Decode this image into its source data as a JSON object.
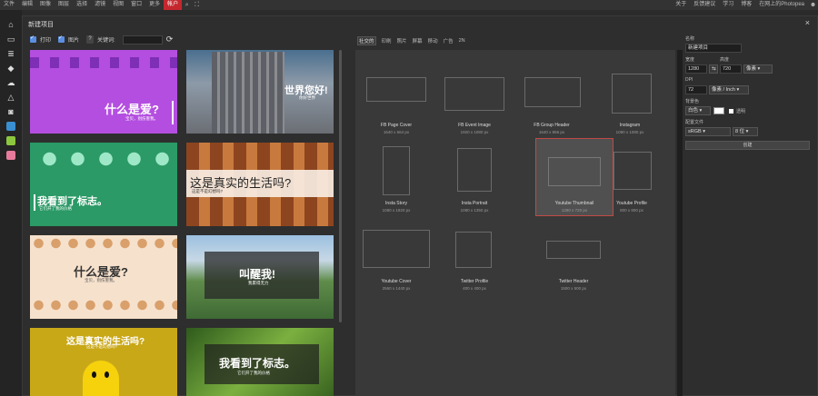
{
  "menubar": {
    "items": [
      "文件",
      "编辑",
      "图像",
      "图层",
      "选择",
      "滤镜",
      "视图",
      "窗口",
      "更多"
    ],
    "account": "帐户",
    "right_items": [
      "关于",
      "反馈建议",
      "学习",
      "博客",
      "在网上的Photopea"
    ]
  },
  "dialog": {
    "title": "新建项目",
    "close": "×"
  },
  "template_toolbar": {
    "print_label": "打印",
    "image_label": "图片",
    "question": "?",
    "keyword_label": "关键词:",
    "keyword_value": ""
  },
  "templates": [
    {
      "big": "什么是爱?",
      "small": "宝贝，别伤害我。",
      "bg": "#b44ee0"
    },
    {
      "big": "世界您好!",
      "small": "你好世界",
      "bg": "#6d7a8c"
    },
    {
      "big": "我看到了标志。",
      "small": "它们开了我的价格",
      "bg": "#2b9a66"
    },
    {
      "big": "这是真实的生活吗?",
      "small": "这是不是幻想吗?",
      "bg": "#b86a35"
    },
    {
      "big": "什么是爱?",
      "small": "宝贝，别伤害我。",
      "bg": "#f6e1cc"
    },
    {
      "big": "叫醒我!",
      "small": "我累得无力",
      "bg": "#7ea65a"
    },
    {
      "big": "这是真实的生活吗?",
      "small": "这是不是幻想吗?",
      "bg": "#c9a818"
    },
    {
      "big": "我看到了标志。",
      "small": "它们开了我的价格",
      "bg": "#4f7d2a"
    }
  ],
  "preset_tabs": [
    "社交的",
    "印刷",
    "照片",
    "屏幕",
    "移动",
    "广告",
    "2N"
  ],
  "presets": [
    {
      "name": "FB Page Cover",
      "size": "1640 x 664 px"
    },
    {
      "name": "FB Event Image",
      "size": "1920 x 1080 px"
    },
    {
      "name": "FB Group Header",
      "size": "1640 x 856 px"
    },
    {
      "name": "Instagram",
      "size": "1080 x 1080 px"
    },
    {
      "name": "Insta Story",
      "size": "1080 x 1920 px"
    },
    {
      "name": "Insta Portrait",
      "size": "1080 x 1350 px"
    },
    {
      "name": "Youtube Thumbnail",
      "size": "1280 x 720 px"
    },
    {
      "name": "Youtube Profile",
      "size": "800 x 800 px"
    },
    {
      "name": "Youtube Cover",
      "size": "2560 x 1440 px"
    },
    {
      "name": "Twitter Profile",
      "size": "400 x 400 px"
    },
    {
      "name": "Twitter Header",
      "size": "1500 x 500 px"
    }
  ],
  "settings": {
    "name_label": "名称",
    "name_value": "新建项目",
    "width_label": "宽度",
    "height_label": "高度",
    "width_value": "1280",
    "height_value": "720",
    "link_icon": "⇆",
    "unit": "像素",
    "dpi_label": "DPI",
    "dpi_value": "72",
    "dpi_unit": "像素 / Inch",
    "bg_label": "背景色",
    "bg_value": "白色",
    "transparent_label": "透明",
    "profile_label": "配置文件",
    "profile_value": "sRGB",
    "bits_value": "8 位",
    "create_label": "创建"
  }
}
